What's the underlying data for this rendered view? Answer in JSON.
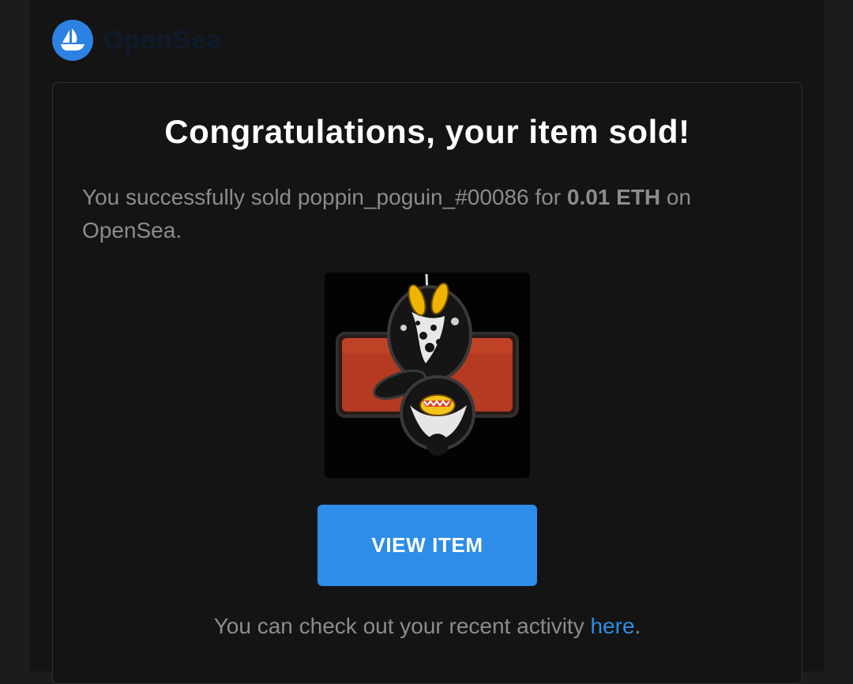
{
  "brand": {
    "name": "OpenSea",
    "logo_icon": "opensea-sailboat-icon",
    "accent_color": "#2d8de8"
  },
  "email": {
    "title": "Congratulations, your item sold!",
    "message_prefix": "You successfully sold poppin_poguin_#00086 for ",
    "price": "0.01 ETH",
    "message_suffix": " on OpenSea.",
    "item_image": "nft-penguin-image",
    "cta_label": "VIEW ITEM",
    "footer_prefix": "You can check out your recent activity ",
    "footer_link": "here",
    "footer_suffix": "."
  }
}
